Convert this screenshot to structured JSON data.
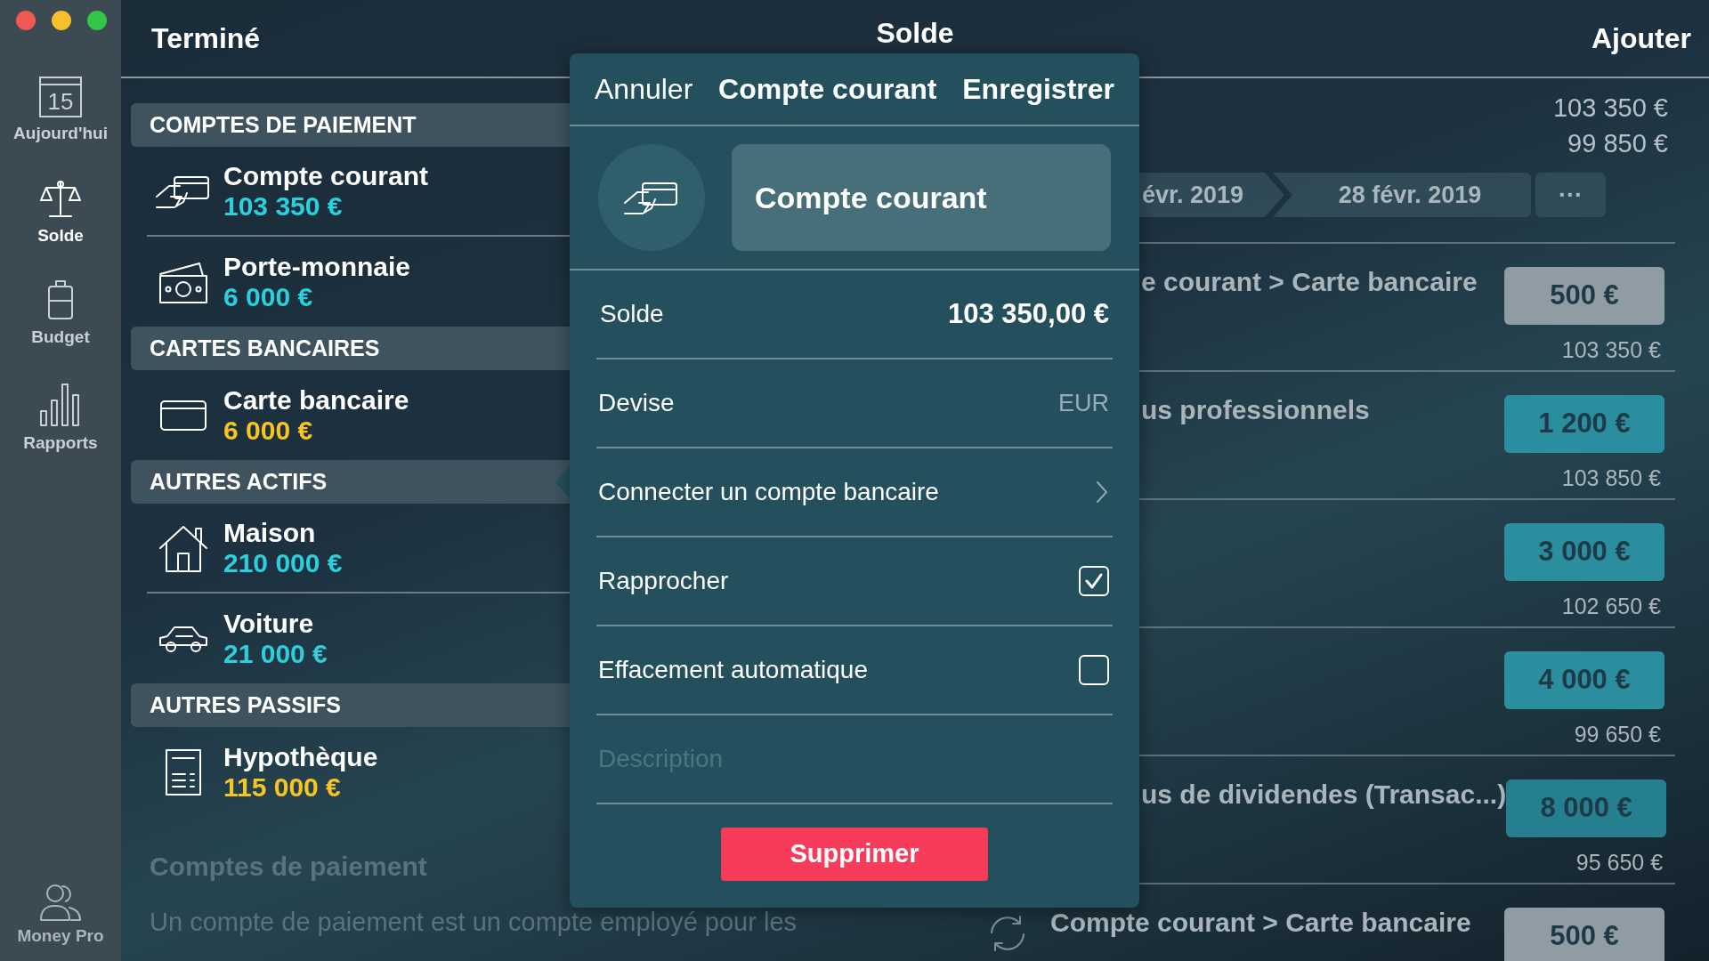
{
  "sidebar": {
    "items": [
      {
        "label": "Aujourd'hui",
        "icon_text": "15",
        "selected": false
      },
      {
        "label": "Solde",
        "selected": true
      },
      {
        "label": "Budget",
        "selected": false
      },
      {
        "label": "Rapports",
        "selected": false
      }
    ],
    "footer": {
      "label": "Money Pro"
    }
  },
  "toolbar": {
    "left": "Terminé",
    "title": "Solde",
    "right": "Ajouter"
  },
  "accounts": {
    "sections": [
      {
        "title": "COMPTES DE PAIEMENT",
        "items": [
          {
            "name": "Compte courant",
            "amount": "103 350 €",
            "color": "#2ccfdc"
          },
          {
            "name": "Porte-monnaie",
            "amount": "6 000 €",
            "color": "#2ccfdc"
          }
        ]
      },
      {
        "title": "CARTES BANCAIRES",
        "items": [
          {
            "name": "Carte bancaire",
            "amount": "6 000 €",
            "color": "#f6c521"
          }
        ]
      },
      {
        "title": "AUTRES ACTIFS",
        "items": [
          {
            "name": "Maison",
            "amount": "210 000 €",
            "color": "#2ccfdc"
          },
          {
            "name": "Voiture",
            "amount": "21 000 €",
            "color": "#2ccfdc"
          }
        ]
      },
      {
        "title": "AUTRES PASSIFS",
        "items": [
          {
            "name": "Hypothèque",
            "amount": "115 000 €",
            "color": "#f6c521"
          }
        ]
      }
    ]
  },
  "help": {
    "title": "Comptes de paiement",
    "text": "Un compte de paiement est un compte employé pour les"
  },
  "summary": {
    "values": [
      "103 350 €",
      "99 850 €"
    ]
  },
  "periods": [
    {
      "label": "évr. 2019"
    },
    {
      "label": "28 févr. 2019"
    },
    {
      "label": "···"
    }
  ],
  "transactions": [
    {
      "kind": "covered",
      "title": "e courant > Carte bancaire",
      "amount": "500 €",
      "balance": "103 350 €",
      "color": "#8f9ca4"
    },
    {
      "kind": "covered",
      "title": "us professionnels",
      "amount": "1 200 €",
      "balance": "103 850 €",
      "color": "#2a8e9e"
    },
    {
      "kind": "covered",
      "amount": "3 000 €",
      "balance": "102 650 €",
      "color": "#2a8e9e"
    },
    {
      "kind": "covered",
      "amount": "4 000 €",
      "balance": "99 650 €",
      "color": "#2a8e9e"
    },
    {
      "kind": "covered",
      "title": "us de dividendes (Transac...)",
      "amount": "8 000 €",
      "balance": "95 650 €",
      "color": "#267f8f"
    },
    {
      "kind": "transfer",
      "title": "Compte courant > Carte bancaire",
      "amount": "500 €",
      "color": "#8f9ca4"
    }
  ],
  "editor": {
    "cancel": "Annuler",
    "title": "Compte courant",
    "save": "Enregistrer",
    "name": "Compte courant",
    "rows": [
      {
        "kind": "amount",
        "label": "Solde",
        "value": "103 350,00 €"
      },
      {
        "kind": "option",
        "label": "Devise",
        "value": "EUR"
      },
      {
        "kind": "link",
        "label": "Connecter un compte bancaire"
      },
      {
        "kind": "check",
        "label": "Rapprocher",
        "checked": true
      },
      {
        "kind": "check",
        "label": "Effacement automatique",
        "checked": false
      },
      {
        "kind": "text",
        "placeholder": "Description"
      }
    ],
    "delete": "Supprimer"
  }
}
